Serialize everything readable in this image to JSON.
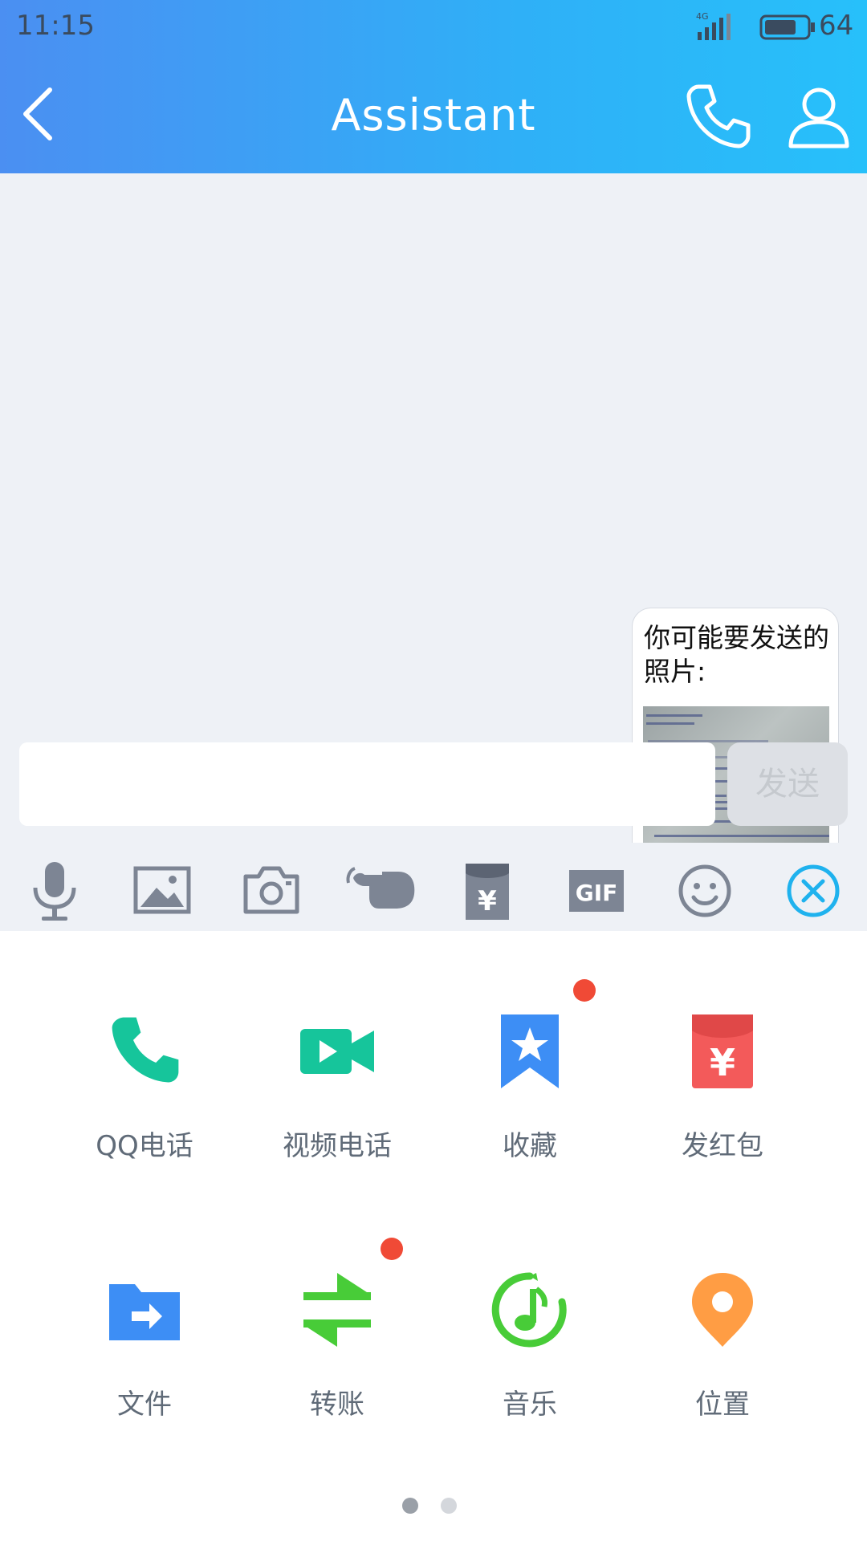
{
  "status_bar": {
    "time": "11:15",
    "network": "4G",
    "battery": "64"
  },
  "header": {
    "title": "Assistant"
  },
  "chat": {
    "message_text": "你可能要发送的照片:"
  },
  "composer": {
    "input_value": "",
    "send_label": "发送"
  },
  "toolbar": {
    "items": [
      {
        "icon": "microphone-icon"
      },
      {
        "icon": "image-icon"
      },
      {
        "icon": "camera-icon"
      },
      {
        "icon": "poke-hand-icon"
      },
      {
        "icon": "red-packet-icon"
      },
      {
        "icon": "gif-icon",
        "text": "GIF"
      },
      {
        "icon": "emoji-icon"
      },
      {
        "icon": "close-icon"
      }
    ]
  },
  "panel": {
    "items": [
      {
        "label": "QQ电话",
        "icon": "phone-icon",
        "badge": false
      },
      {
        "label": "视频电话",
        "icon": "video-call-icon",
        "badge": false
      },
      {
        "label": "收藏",
        "icon": "favorite-bookmark-icon",
        "badge": true
      },
      {
        "label": "发红包",
        "icon": "red-envelope-icon",
        "badge": false
      },
      {
        "label": "文件",
        "icon": "folder-icon",
        "badge": false
      },
      {
        "label": "转账",
        "icon": "transfer-icon",
        "badge": true
      },
      {
        "label": "音乐",
        "icon": "music-icon",
        "badge": false
      },
      {
        "label": "位置",
        "icon": "location-pin-icon",
        "badge": false
      }
    ],
    "page_count": 2,
    "current_page": 1
  },
  "colors": {
    "header_start": "#4b8ff2",
    "header_end": "#27c0fa",
    "chat_bg": "#eef1f6",
    "badge_red": "#f04a36",
    "accent_blue": "#1fb2ee"
  }
}
